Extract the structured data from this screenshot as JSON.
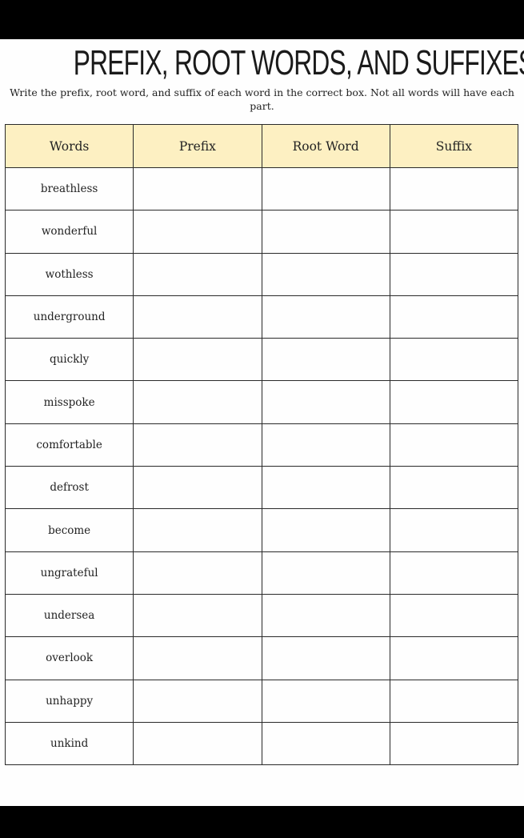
{
  "worksheet": {
    "title": "PREFIX, ROOT WORDS, AND SUFFIXES",
    "instructions": "Write the prefix, root word, and suffix of each word in the correct box. Not all words will have each part.",
    "columns": [
      "Words",
      "Prefix",
      "Root Word",
      "Suffix"
    ],
    "words": [
      "breathless",
      "wonderful",
      "wothless",
      "underground",
      "quickly",
      "misspoke",
      "comfortable",
      "defrost",
      "become",
      "ungrateful",
      "undersea",
      "overlook",
      "unhappy",
      "unkind"
    ],
    "header_color": "#fdf0c2"
  }
}
